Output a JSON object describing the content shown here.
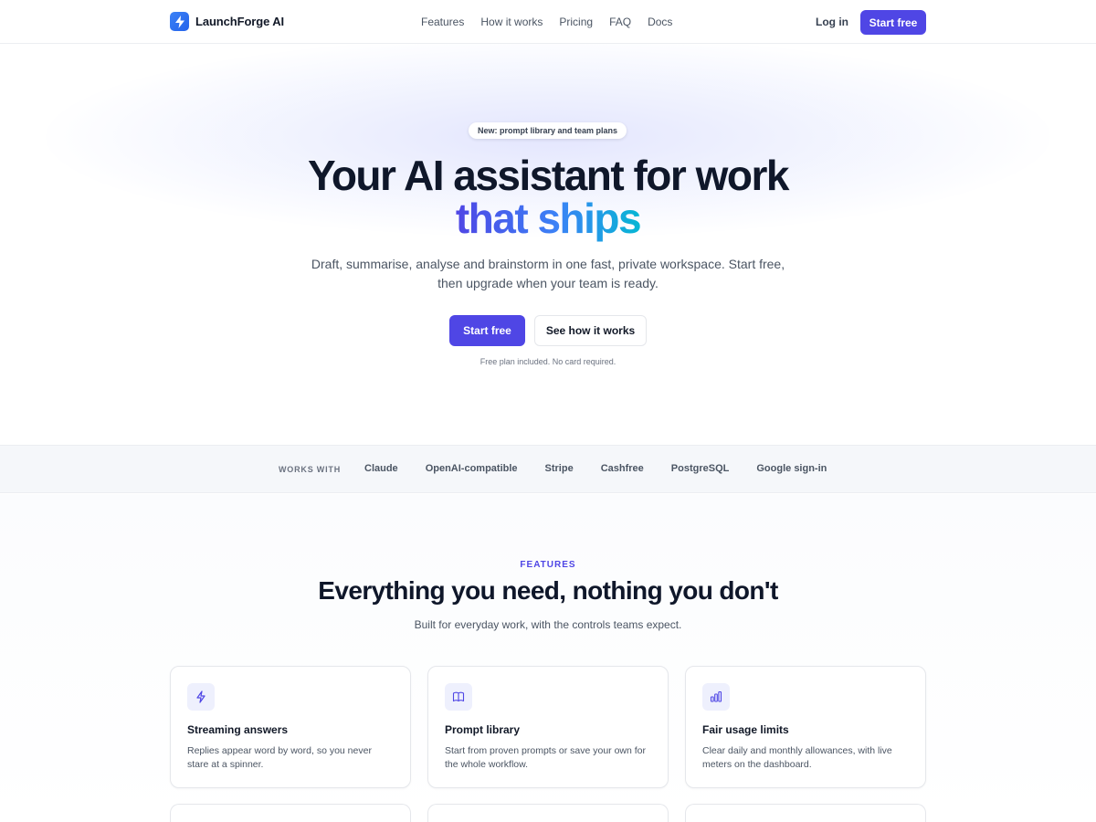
{
  "brand": {
    "name": "LaunchForge AI",
    "logo_icon": "bolt-icon",
    "accent": "#4f46e5"
  },
  "nav": {
    "links": [
      "Features",
      "How it works",
      "Pricing",
      "FAQ",
      "Docs"
    ],
    "login": "Log in",
    "cta": "Start free"
  },
  "hero": {
    "badge": "New: prompt library and team plans",
    "title_line1": "Your AI assistant for work",
    "title_line2": "that ships",
    "subtitle": "Draft, summarise, analyse and brainstorm in one fast, private workspace. Start free, then upgrade when your team is ready.",
    "primary_cta": "Start free",
    "secondary_cta": "See how it works",
    "note": "Free plan included. No card required."
  },
  "works_with": {
    "label": "WORKS WITH",
    "items": [
      "Claude",
      "OpenAI-compatible",
      "Stripe",
      "Cashfree",
      "PostgreSQL",
      "Google sign-in"
    ]
  },
  "features": {
    "eyebrow": "FEATURES",
    "title": "Everything you need, nothing you don't",
    "subtitle": "Built for everyday work, with the controls teams expect.",
    "cards": [
      {
        "icon": "bolt-icon",
        "title": "Streaming answers",
        "description": "Replies appear word by word, so you never stare at a spinner."
      },
      {
        "icon": "book-icon",
        "title": "Prompt library",
        "description": "Start from proven prompts or save your own for the whole workflow."
      },
      {
        "icon": "bar-chart-icon",
        "title": "Fair usage limits",
        "description": "Clear daily and monthly allowances, with live meters on the dashboard."
      }
    ]
  }
}
